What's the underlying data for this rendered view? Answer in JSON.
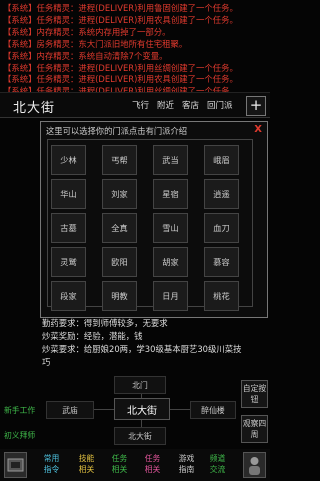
{
  "log": [
    "【系统】任务精灵：进程(DELIVER)利用鲁固创建了一个任务。",
    "【系统】任务精灵：进程(DELIVER)利用农具创建了一个任务。",
    "【系统】内存精灵：系统内存用掉了一部分。",
    "【系统】房务精灵：东大门派旧地所有住宅租聚。",
    "【系统】内存精灵：系统自动清除7个变量。",
    "【系统】任务精灵：进程(DELIVER)利用丝绸创建了一个任务。",
    "【系统】任务精灵：进程(DELIVER)利用农具创建了一个任务。",
    "【系统】任务精灵：进程(DELIVER)利用丝绸创建了一个任务。"
  ],
  "header": {
    "title": "北大街",
    "nav": [
      "飞行",
      "附近",
      "客店",
      "回门派"
    ],
    "plus": "+"
  },
  "dialog": {
    "title": "这里可以选择你的门派点击有门派介绍",
    "close": "X",
    "sects": [
      [
        "少林",
        "丐帮",
        "武当",
        "峨眉"
      ],
      [
        "华山",
        "刘家",
        "星宿",
        "逍遥"
      ],
      [
        "古墓",
        "全真",
        "雪山",
        "血刀"
      ],
      [
        "灵鹫",
        "欧阳",
        "胡家",
        "慕容"
      ],
      [
        "段家",
        "明教",
        "日月",
        "桃花"
      ]
    ]
  },
  "info": [
    "勤药要求：得到师傅较多，无要求",
    "炒菜奖励：经验，潜能，钱",
    "炒菜要求：给厨娘20两，学30级基本厨艺30级川菜技",
    "巧"
  ],
  "side_links": {
    "new_player": "新手工作",
    "beginner": "初义拜师"
  },
  "map": {
    "north": "北门",
    "west": "武庙",
    "current": "北大街",
    "east": "醉仙楼",
    "south": "北大街"
  },
  "side_buttons": {
    "set_button": "自定按钮",
    "look_around": "观察四周"
  },
  "bottom": [
    {
      "label": "常用指令",
      "color": "#4ec3e0"
    },
    {
      "label": "技能相关",
      "color": "#e0c040"
    },
    {
      "label": "任务相关",
      "color": "#3fb94a"
    },
    {
      "label": "任务相关",
      "color": "#e0559a"
    },
    {
      "label": "游戏指南",
      "color": "#cccccc"
    },
    {
      "label": "频道交流",
      "color": "#3fb94a"
    }
  ]
}
